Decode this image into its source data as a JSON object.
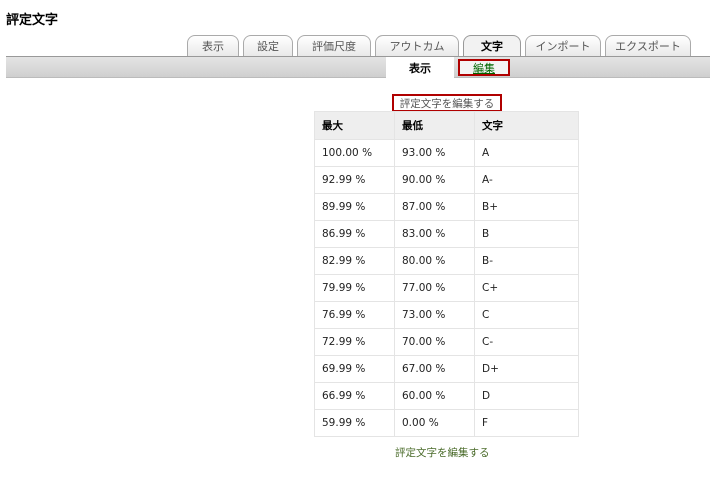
{
  "page": {
    "title": "評定文字"
  },
  "tabs": [
    {
      "label": "表示",
      "active": false
    },
    {
      "label": "設定",
      "active": false
    },
    {
      "label": "評価尺度",
      "active": false
    },
    {
      "label": "アウトカム",
      "active": false
    },
    {
      "label": "文字",
      "active": true
    },
    {
      "label": "インポート",
      "active": false
    },
    {
      "label": "エクスポート",
      "active": false
    }
  ],
  "subtabs": {
    "view": "表示",
    "edit": "編集"
  },
  "edit_link_label": "評定文字を編集する",
  "table": {
    "headers": [
      "最大",
      "最低",
      "文字"
    ],
    "rows": [
      [
        "100.00 %",
        "93.00 %",
        "A"
      ],
      [
        "92.99 %",
        "90.00 %",
        "A-"
      ],
      [
        "89.99 %",
        "87.00 %",
        "B+"
      ],
      [
        "86.99 %",
        "83.00 %",
        "B"
      ],
      [
        "82.99 %",
        "80.00 %",
        "B-"
      ],
      [
        "79.99 %",
        "77.00 %",
        "C+"
      ],
      [
        "76.99 %",
        "73.00 %",
        "C"
      ],
      [
        "72.99 %",
        "70.00 %",
        "C-"
      ],
      [
        "69.99 %",
        "67.00 %",
        "D+"
      ],
      [
        "66.99 %",
        "60.00 %",
        "D"
      ],
      [
        "59.99 %",
        "0.00 %",
        "F"
      ]
    ]
  }
}
